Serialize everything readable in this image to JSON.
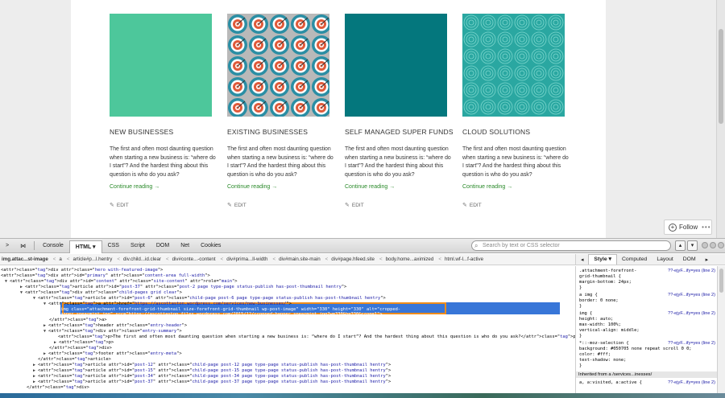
{
  "site": {
    "cards": [
      {
        "title": "NEW BUSINESSES",
        "excerpt": "The first and often most daunting question when starting a new business is: “where do I start”? And the hardest thing about this question is who do you ask?",
        "more": "Continue reading →",
        "edit": "EDIT",
        "thumb": "solid",
        "color": "#4dc79b"
      },
      {
        "title": "EXISTING BUSINESSES",
        "excerpt": "The first and often most daunting question when starting a new business is: “where do I start”? And the hardest thing about this question is who do you ask?",
        "more": "Continue reading →",
        "edit": "EDIT",
        "thumb": "target-pattern",
        "color": "#2a8ea4"
      },
      {
        "title": "SELF MANAGED SUPER FUNDS",
        "excerpt": "The first and often most daunting question when starting a new business is: “where do I start”? And the hardest thing about this question is who do you ask?",
        "more": "Continue reading →",
        "edit": "EDIT",
        "thumb": "solid",
        "color": "#04777d"
      },
      {
        "title": "CLOUD SOLUTIONS",
        "excerpt": "The first and often most daunting question when starting a new business is: “where do I start”? And the hardest thing about this question is who do you ask?",
        "more": "Continue reading →",
        "edit": "EDIT",
        "thumb": "cloud-pattern",
        "color": "#2aa7a1"
      }
    ],
    "follow": {
      "label": "Follow",
      "more": "•••"
    }
  },
  "devtools": {
    "tabs": [
      "Console",
      "HTML ▾",
      "CSS",
      "Script",
      "DOM",
      "Net",
      "Cookies"
    ],
    "active_tab": "HTML ▾",
    "search_placeholder": "Search by text or CSS selector",
    "breadcrumbs": [
      "img.attac...st-image",
      "a",
      "article#p...l.hentry",
      "div.child...id.clear",
      "div#conte...-content",
      "div#prima...ll-width",
      "div#main.site-main",
      "div#page.hfeed.site",
      "body.home...aximized",
      "html.wf-l...f-active"
    ],
    "side_tabs": [
      "Style ▾",
      "Computed",
      "Layout",
      "DOM"
    ],
    "active_side_tab": "Style ▾",
    "html_lines": [
      "<div class=\"hero with-featured-image\">",
      "<div id=\"primary\" class=\"content-area full-width\">",
      "<div id=\"content\" class=\"site-content\" role=\"main\">",
      "<article id=\"post-37\" class=\"post-2 page type-page status-publish has-post-thumbnail hentry\">",
      "<div class=\"child-pages grid clear\">",
      "<article id=\"post-6\" class=\"child-page post-6 page type-page status-publish has-post-thumbnail hentry\">",
      "<a href=\"https://ascottaston.wordpress.com/services/new-businesses/\">",
      "<img class=\"attachment-forefront-grid-thumbnail size-forefront-grid-thumbnail wp-post-image\" width=\"330\" height=\"330\" alt=\"cropped-",
      "banner_spearmint.jpg\" src=\"https://ascottaston.files.wordpress.com/2015/12/cropped-banner_spearmint.jpg?w=330&h=330&crop=1\">",
      "</a>",
      "<header class=\"entry-header\">",
      "<div class=\"entry-summary\">",
      "<p>The first and often most daunting question when starting a new business is: “where do I start”? And the hardest thing about this question is who do you ask?</p>",
      "<p>",
      "</div>",
      "<footer class=\"entry-meta\">",
      "</article>",
      "<article id=\"post-12\" class=\"child-page post-12 page type-page status-publish has-post-thumbnail hentry\">",
      "<article id=\"post-15\" class=\"child-page post-15 page type-page status-publish has-post-thumbnail hentry\">",
      "<article id=\"post-34\" class=\"child-page post-34 page type-page status-publish has-post-thumbnail hentry\">",
      "<article id=\"post-37\" class=\"child-page post-37 page type-page status-publish has-post-thumbnail hentry\">",
      "</div>"
    ],
    "style_rules": [
      {
        "lines": [
          ".attachment-forefront-",
          "grid-thumbnail {",
          "    margin-bottom: 24px;",
          "}"
        ],
        "source": "??-ejyF...ify=yes (line 2)"
      },
      {
        "lines": [
          "a img {",
          "    border: 0 none;",
          "}"
        ],
        "source": "??-ejyF...ify=yes (line 2)"
      },
      {
        "lines": [
          "img {",
          "    height: auto;",
          "    max-width: 100%;",
          "    vertical-align: middle;",
          "}"
        ],
        "source": "??-ejyF...ify=yes (line 2)"
      },
      {
        "lines": [
          "*::-moz-selection {",
          "    background: #050705 none repeat scroll 0 0;",
          "    color: #fff;",
          "    text-shadow: none;",
          "}"
        ],
        "source": "??-ejyF...ify=yes (line 2)"
      }
    ],
    "inherited_label": "Inherited from a /services...inesses/",
    "last_rule": {
      "line": "a, a:visited, a:active {",
      "source": "??-ejyF...ify=yes (line 2)"
    }
  }
}
